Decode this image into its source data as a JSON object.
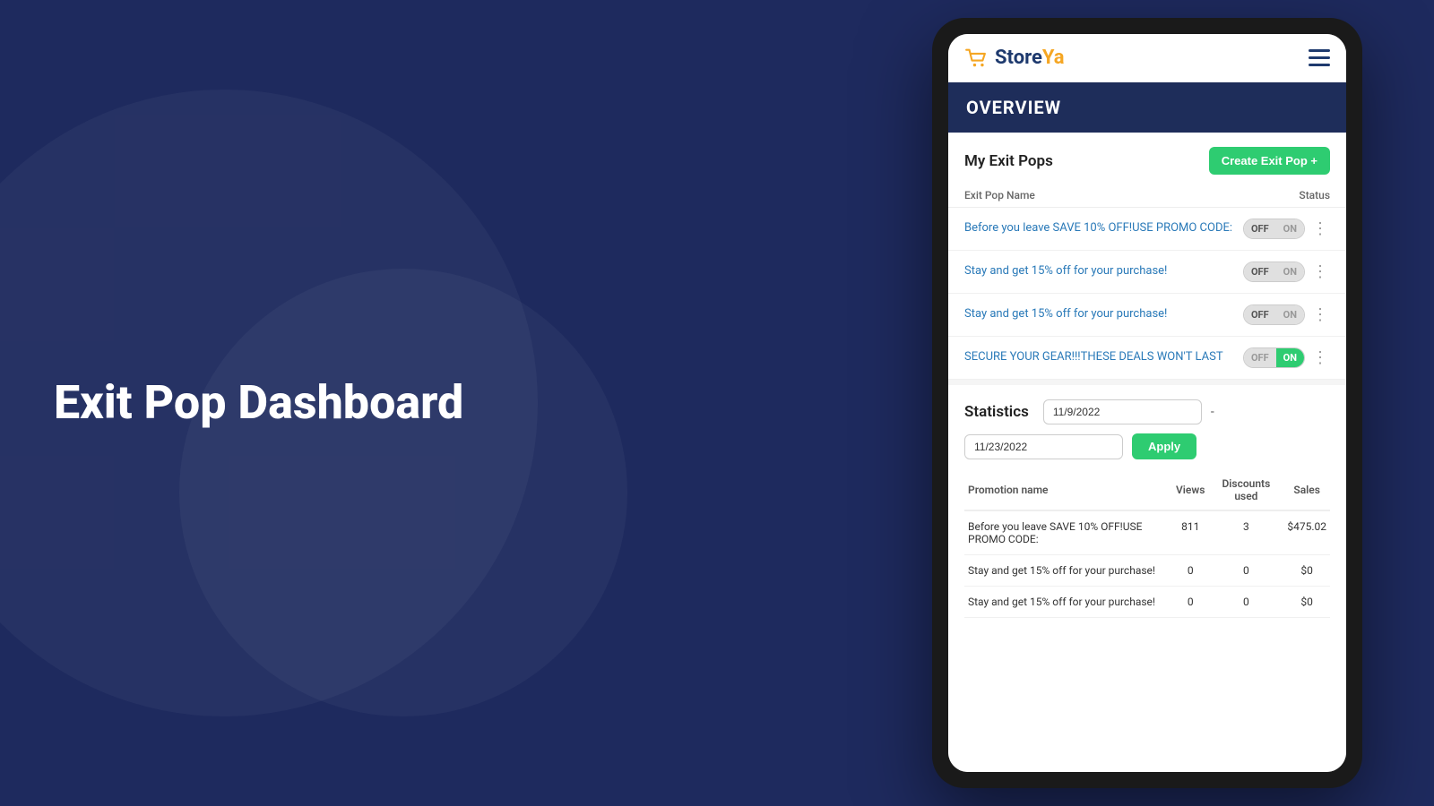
{
  "background": {
    "color": "#1e2a5e"
  },
  "left_panel": {
    "heading_line1": "Exit Pop Dashboard"
  },
  "app": {
    "logo": {
      "store": "Store",
      "ya": "Ya"
    },
    "header": {
      "hamburger_label": "menu"
    },
    "overview_banner": {
      "title": "OVERVIEW"
    },
    "exit_pops_section": {
      "title": "My Exit Pops",
      "create_button": "Create Exit Pop +",
      "table_headers": {
        "name": "Exit Pop Name",
        "status": "Status"
      },
      "rows": [
        {
          "name": "Before you leave SAVE 10% OFF!USE PROMO CODE:",
          "status_off": "OFF",
          "status_on": "ON",
          "is_on": false
        },
        {
          "name": "Stay and get 15% off for your purchase!",
          "status_off": "OFF",
          "status_on": "ON",
          "is_on": false
        },
        {
          "name": "Stay and get 15% off for your purchase!",
          "status_off": "OFF",
          "status_on": "ON",
          "is_on": false
        },
        {
          "name": "SECURE YOUR GEAR!!!THESE DEALS WON'T LAST",
          "status_off": "OFF",
          "status_on": "ON",
          "is_on": true
        }
      ]
    },
    "statistics_section": {
      "title": "Statistics",
      "date_from": "11/9/2022",
      "date_separator": "-",
      "date_to": "11/23/2022",
      "apply_button": "Apply",
      "table_headers": {
        "promotion_name": "Promotion name",
        "views": "Views",
        "discounts_used": "Discounts used",
        "sales": "Sales"
      },
      "rows": [
        {
          "name": "Before you leave SAVE 10% OFF!USE PROMO CODE:",
          "views": "811",
          "discounts": "3",
          "sales": "$475.02"
        },
        {
          "name": "Stay and get 15% off for your purchase!",
          "views": "0",
          "discounts": "0",
          "sales": "$0"
        },
        {
          "name": "Stay and get 15% off for your purchase!",
          "views": "0",
          "discounts": "0",
          "sales": "$0"
        }
      ]
    }
  }
}
